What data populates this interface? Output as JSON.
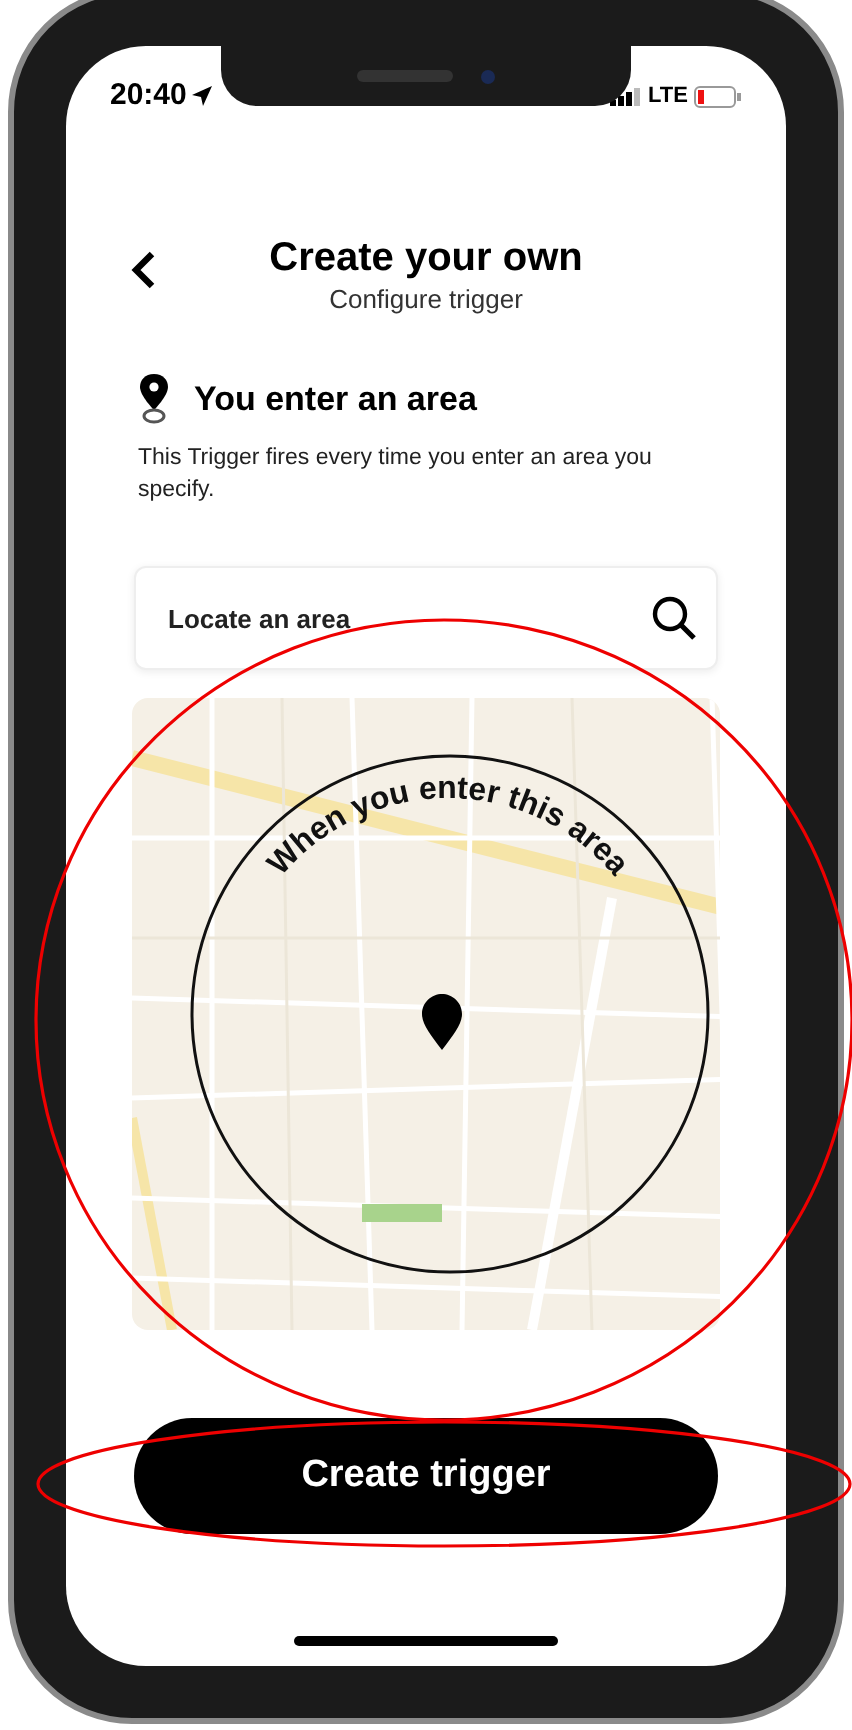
{
  "status_bar": {
    "time": "20:40",
    "network": "LTE"
  },
  "header": {
    "title": "Create your own",
    "subtitle": "Configure trigger"
  },
  "trigger": {
    "title": "You enter an area",
    "description": "This Trigger fires every time you enter an area you specify."
  },
  "search": {
    "placeholder": "Locate an area"
  },
  "map": {
    "kind": "picture",
    "caption": "When you enter this area"
  },
  "button": {
    "label": "Create trigger"
  }
}
